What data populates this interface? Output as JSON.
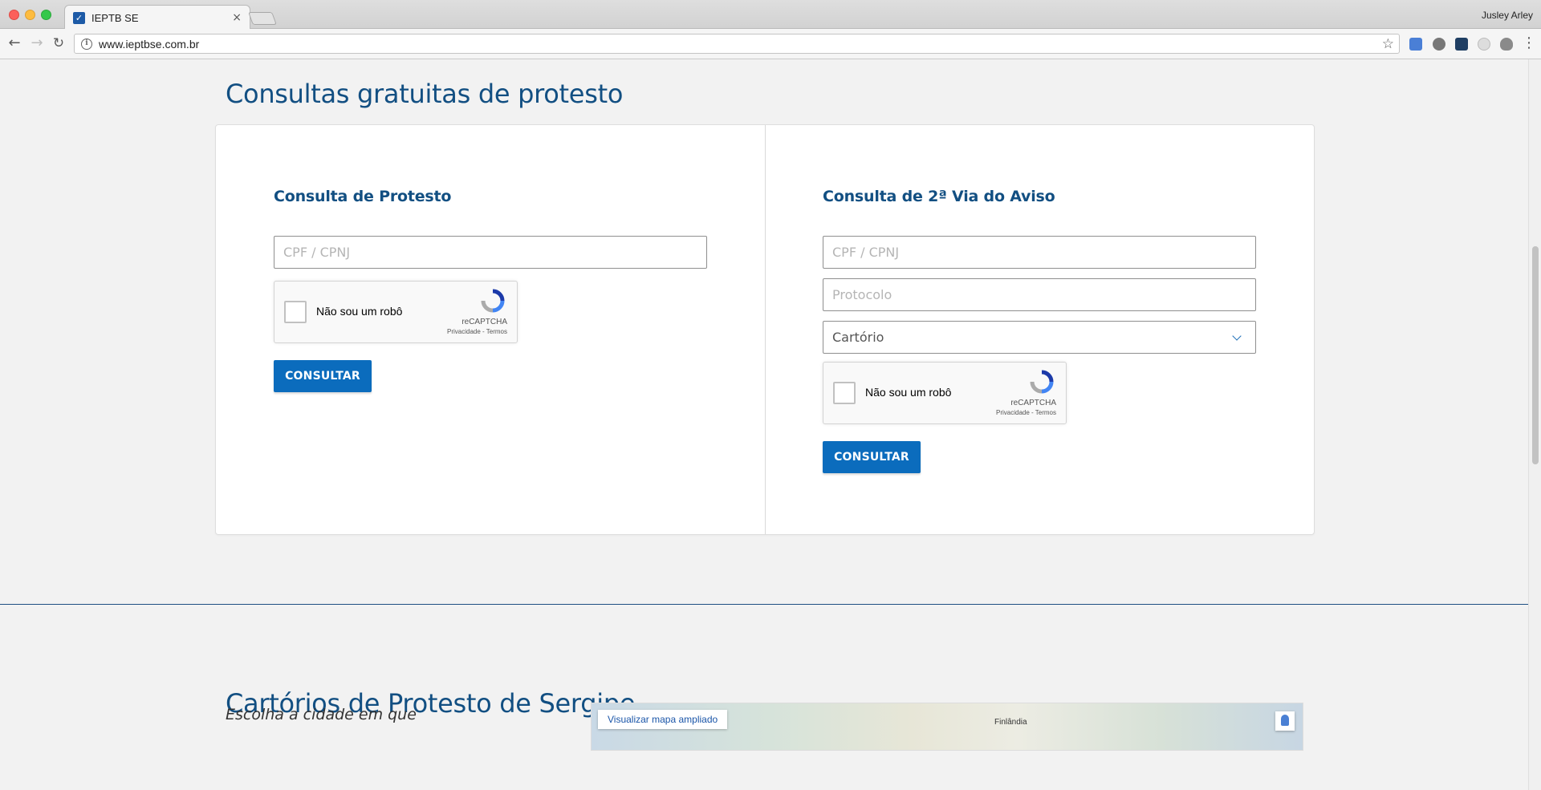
{
  "browser": {
    "tab_title": "IEPTB SE",
    "tab_close": "×",
    "profile_name": "Jusley Arley",
    "url": "www.ieptbse.com.br"
  },
  "page": {
    "section_title": "Consultas gratuitas de protesto",
    "left_panel": {
      "heading": "Consulta de Protesto",
      "cpf_placeholder": "CPF / CPNJ",
      "recaptcha_label": "Não sou um robô",
      "recaptcha_brand": "reCAPTCHA",
      "recaptcha_links": "Privacidade - Termos",
      "button_label": "CONSULTAR"
    },
    "right_panel": {
      "heading": "Consulta de 2ª Via do Aviso",
      "cpf_placeholder": "CPF / CPNJ",
      "protocolo_placeholder": "Protocolo",
      "cartorio_selected": "Cartório",
      "recaptcha_label": "Não sou um robô",
      "recaptcha_brand": "reCAPTCHA",
      "recaptcha_links": "Privacidade - Termos",
      "button_label": "CONSULTAR"
    },
    "cartorios_title": "Cartórios de Protesto de Sergipe",
    "city_prompt": "Escolha a cidade em que",
    "map": {
      "view_larger_link": "Visualizar mapa ampliado",
      "place_label": "Finlândia"
    }
  },
  "colors": {
    "brand_blue": "#124f82",
    "button_blue": "#0b6cbd",
    "page_bg": "#f2f2f2"
  }
}
